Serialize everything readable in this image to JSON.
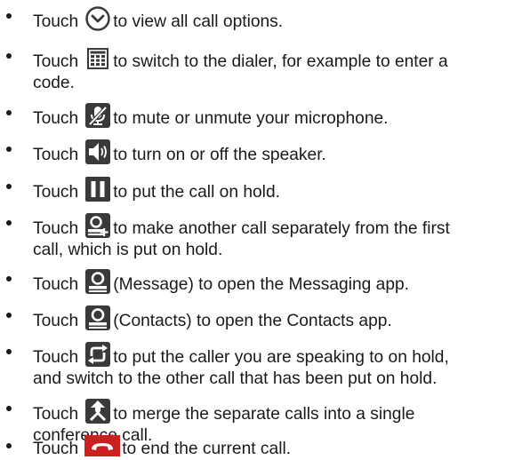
{
  "items": [
    {
      "prefix": "Touch",
      "icon": "chevron-down-circle-icon",
      "rest": "to view all call options."
    },
    {
      "prefix": "Touch",
      "icon": "dialpad-icon",
      "rest": "to switch to the dialer, for example to enter a",
      "cont": "code."
    },
    {
      "prefix": "Touch",
      "icon": "mute-microphone-icon",
      "rest": "to mute or unmute your microphone."
    },
    {
      "prefix": "Touch",
      "icon": "speaker-icon",
      "rest": "to turn on or off the speaker."
    },
    {
      "prefix": "Touch",
      "icon": "pause-icon",
      "rest": "to put the call on hold."
    },
    {
      "prefix": "Touch",
      "icon": "add-call-icon",
      "rest": "to make another call separately from the first",
      "cont": "call, which is put on hold."
    },
    {
      "prefix": "Touch",
      "icon": "contact-icon",
      "rest": "(Message) to open the Messaging app."
    },
    {
      "prefix": "Touch",
      "icon": "contact-icon",
      "rest": "(Contacts) to open the Contacts app."
    },
    {
      "prefix": "Touch",
      "icon": "swap-call-icon",
      "rest": "to put the caller you are speaking to on hold,",
      "cont": "and switch to the other call that has been put on hold."
    },
    {
      "prefix": "Touch",
      "icon": "merge-calls-icon",
      "rest": "to merge the separate calls into a single",
      "cont": "conference call."
    },
    {
      "prefix": "Touch",
      "icon": "end-call-icon",
      "rest": "to end the current call."
    }
  ],
  "colors": {
    "text": "#1a1a1a",
    "icon_bg": "#3a3a3a",
    "icon_fg": "#ffffff",
    "end_call": "#cc1f1f"
  }
}
